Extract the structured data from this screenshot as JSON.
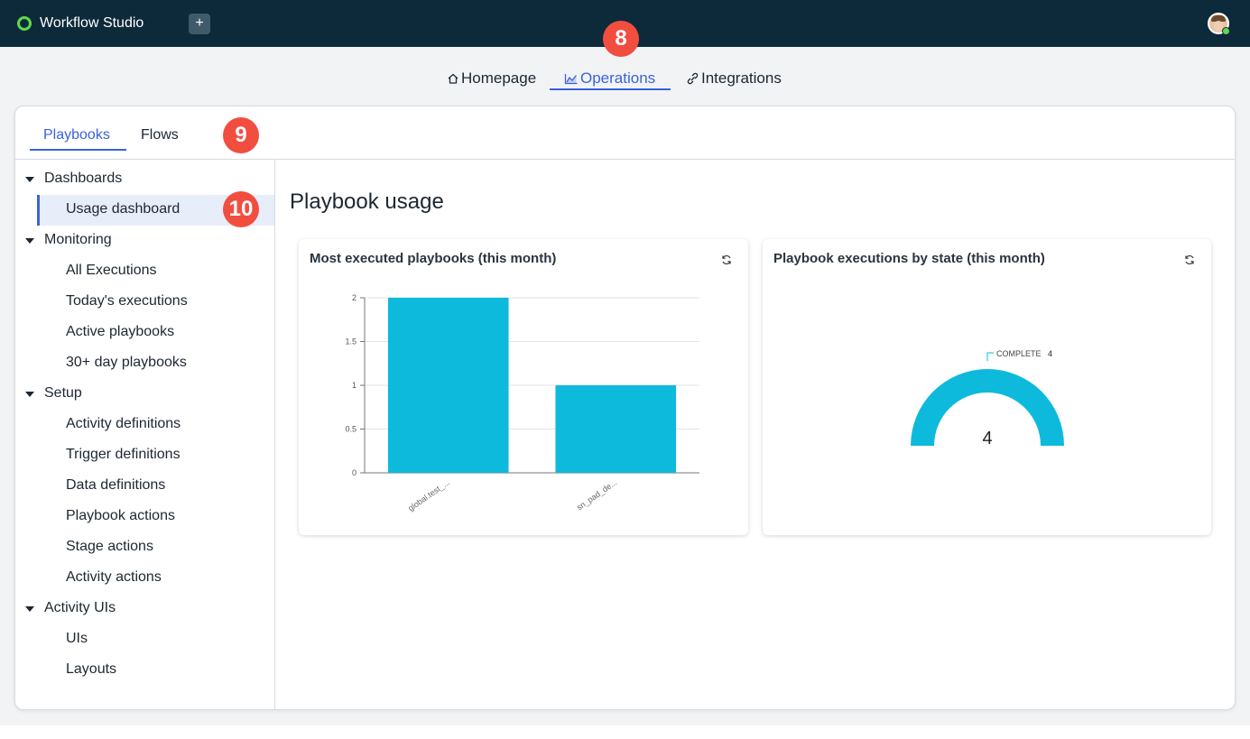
{
  "app": {
    "title": "Workflow Studio",
    "add_label": "+"
  },
  "colors": {
    "accent": "#3b63d9",
    "topbar": "#0d2a3a",
    "bar": "#0dbadc",
    "badge": "#f24e40",
    "logo": "#62d84e"
  },
  "top_nav": {
    "tabs": [
      {
        "label": "Homepage",
        "icon": "home-icon"
      },
      {
        "label": "Operations",
        "icon": "chart-icon",
        "active": true
      },
      {
        "label": "Integrations",
        "icon": "link-icon"
      }
    ]
  },
  "badges": [
    "8",
    "9",
    "10"
  ],
  "sub_tabs": [
    {
      "label": "Playbooks",
      "active": true
    },
    {
      "label": "Flows"
    }
  ],
  "sidebar": {
    "groups": [
      {
        "label": "Dashboards",
        "items": [
          "Usage dashboard"
        ]
      },
      {
        "label": "Monitoring",
        "items": [
          "All Executions",
          "Today's executions",
          "Active playbooks",
          "30+ day playbooks"
        ]
      },
      {
        "label": "Setup",
        "items": [
          "Activity definitions",
          "Trigger definitions",
          "Data definitions",
          "Playbook actions",
          "Stage actions",
          "Activity actions"
        ]
      },
      {
        "label": "Activity UIs",
        "items": [
          "UIs",
          "Layouts"
        ]
      }
    ],
    "selected": "Usage dashboard"
  },
  "main": {
    "title": "Playbook usage"
  },
  "cards": [
    {
      "title": "Most executed playbooks (this month)"
    },
    {
      "title": "Playbook executions by state (this month)"
    }
  ],
  "chart_data": [
    {
      "type": "bar",
      "title": "Most executed playbooks (this month)",
      "categories": [
        "global.test_...",
        "sn_pad_de..."
      ],
      "values": [
        2,
        1
      ],
      "yticks": [
        "0",
        "0.5",
        "1",
        "1.5",
        "2"
      ],
      "ylim": [
        0,
        2
      ],
      "grid": true,
      "xlabel": "",
      "ylabel": ""
    },
    {
      "type": "pie",
      "title": "Playbook executions by state (this month)",
      "style": "semi-donut gauge",
      "slices": [
        {
          "label": "COMPLETE",
          "value": 4
        }
      ],
      "center_value": "4"
    }
  ]
}
